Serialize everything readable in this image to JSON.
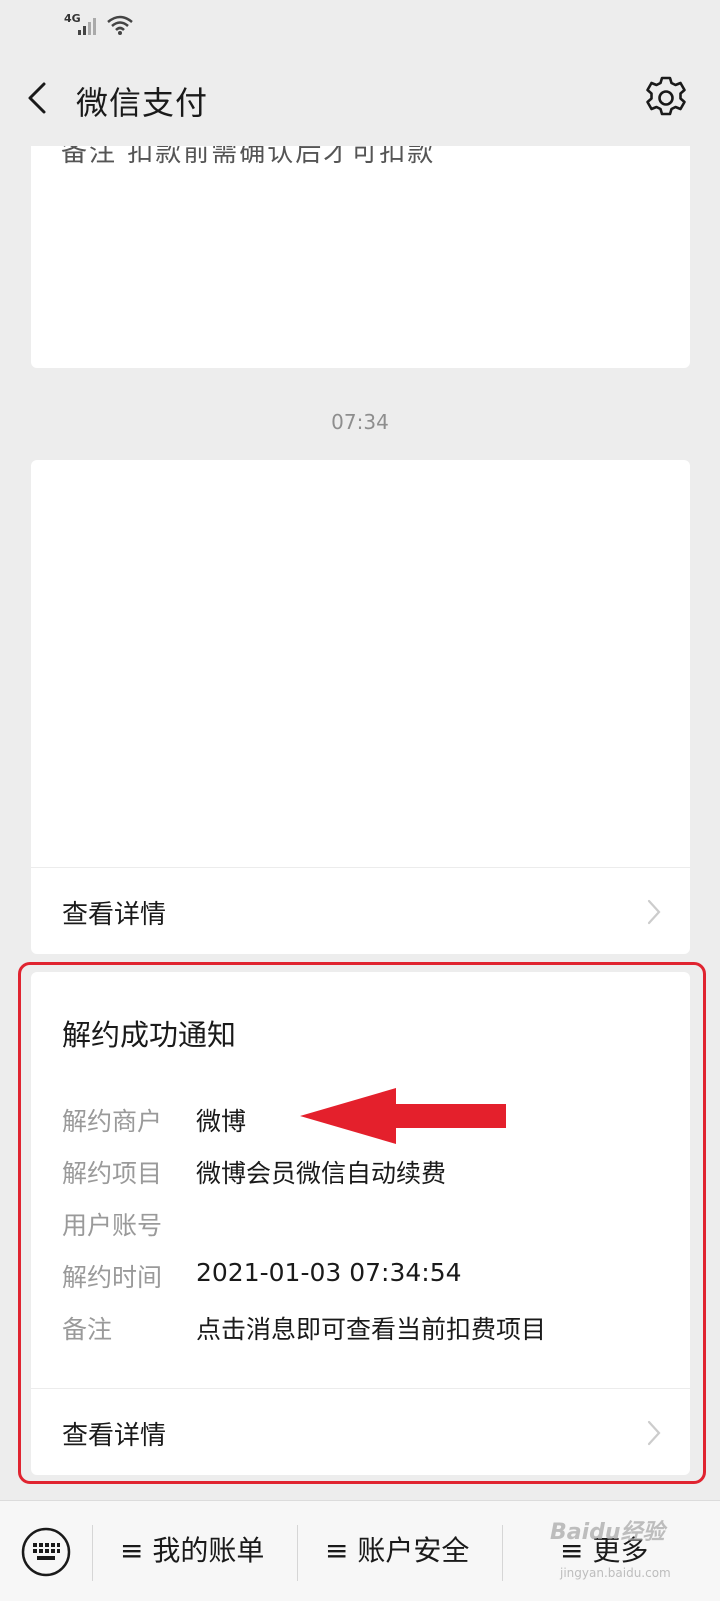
{
  "status_bar": {
    "network": "4G"
  },
  "nav": {
    "title": "微信支付",
    "back_icon": "chevron-left-icon",
    "settings_icon": "gear-icon"
  },
  "top_card": {
    "cut_text": "备注              扣款前需确认后才可扣款"
  },
  "timestamp": "07:34",
  "mid_card": {
    "detail_label": "查看详情"
  },
  "notice": {
    "title": "解约成功通知",
    "fields": [
      {
        "label": "解约商户",
        "value": "微博"
      },
      {
        "label": "解约项目",
        "value": "微博会员微信自动续费"
      },
      {
        "label": "用户账号",
        "value": ""
      },
      {
        "label": "解约时间",
        "value": "2021-01-03 07:34:54"
      },
      {
        "label": "备注",
        "value": "点击消息即可查看当前扣费项目"
      }
    ],
    "detail_label": "查看详情"
  },
  "bottom_menu": {
    "keyboard_icon": "keyboard-icon",
    "items": [
      {
        "label": "≡ 我的账单"
      },
      {
        "label": "≡ 账户安全"
      },
      {
        "label": "≡ 更多"
      }
    ]
  },
  "watermark": {
    "text": "Baidu经验",
    "sub": "jingyan.baidu.com"
  },
  "colors": {
    "highlight": "#e02430",
    "background": "#ededed",
    "card": "#ffffff"
  }
}
